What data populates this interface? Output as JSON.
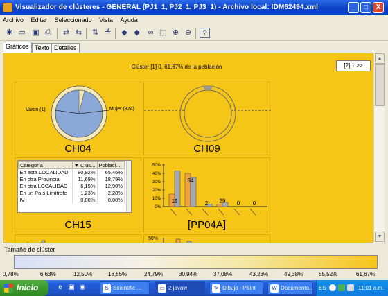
{
  "window": {
    "title": "Visualizador de clústeres - GENERAL (PJ1_1, PJ2_1, PJ3_1) - Archivo local: IDM62494.xml",
    "minimize": "_",
    "maximize": "□",
    "close": "X"
  },
  "menu": [
    "Archivo",
    "Editar",
    "Seleccionado",
    "Vista",
    "Ayuda"
  ],
  "toolbar": [
    "new-file-icon",
    "open-icon",
    "save-icon",
    "print-icon",
    "undo-icon",
    "redo-icon",
    "sort-icon",
    "filter-icon",
    "left-arrow-icon",
    "right-arrow-icon",
    "binoculars-icon",
    "select-icon",
    "zoom-in-icon",
    "zoom-out-icon",
    "help-icon"
  ],
  "tabs": [
    "Gráficos",
    "Texto",
    "Detalles"
  ],
  "panel": {
    "caption": "Clúster [1] 0, 61,67% de la población",
    "nav_button": "[2] 1 >>"
  },
  "charts": {
    "ch04": {
      "label": "CH04",
      "slice_left": "Varon (1)",
      "slice_right": "Mujer (324)"
    },
    "ch09": {
      "label": "CH09"
    },
    "ch15": {
      "label": "CH15"
    },
    "pp04a": {
      "label": "[PP04A]"
    },
    "fifth_axis_label": "50%"
  },
  "chart_data": {
    "type": "bar",
    "title": "[PP04A]",
    "ylim": [
      0,
      50
    ],
    "yticks": [
      "50%",
      "40%",
      "30%",
      "20%",
      "10%",
      "0%"
    ],
    "series": [
      {
        "values": [
          15,
          40,
          0,
          3,
          0,
          0
        ]
      },
      {
        "values": [
          43,
          35,
          3,
          5,
          0,
          0
        ]
      }
    ],
    "data_labels": [
      "15",
      "84",
      "2",
      "29",
      "0",
      "0"
    ]
  },
  "table": {
    "headers": [
      "Categoría",
      "▼ Clús...",
      "Poblaci..."
    ],
    "rows": [
      [
        "En esta LOCALIDAD",
        "80,92%",
        "65,46%"
      ],
      [
        "En otra Provincia",
        "11,69%",
        "18,79%"
      ],
      [
        "En otra LOCALIDAD",
        "6,15%",
        "12,90%"
      ],
      [
        "En un País Limítrofe",
        "1,23%",
        "2,28%"
      ],
      [
        "IV",
        "0,00%",
        "0,00%"
      ]
    ]
  },
  "size_legend": {
    "label": "Tamaño de clúster",
    "ticks": [
      "0,78%",
      "6,63%",
      "12,50%",
      "18,65%",
      "24,79%",
      "30,94%",
      "37,08%",
      "43,23%",
      "49,38%",
      "55,52%",
      "61,67%"
    ]
  },
  "taskbar": {
    "start": "Inicio",
    "items": [
      "Scientific ...",
      "2 javaw",
      "Dibujo - Paint",
      "Documento..."
    ],
    "lang": "ES",
    "clock": "11:01 a.m."
  },
  "colors": {
    "panel": "#F5C518",
    "pie_blue": "#8AA8D8",
    "pie_cream": "#F5E8B8",
    "bar_orange": "#F0A040",
    "bar_gray": "#A8A8B0"
  }
}
